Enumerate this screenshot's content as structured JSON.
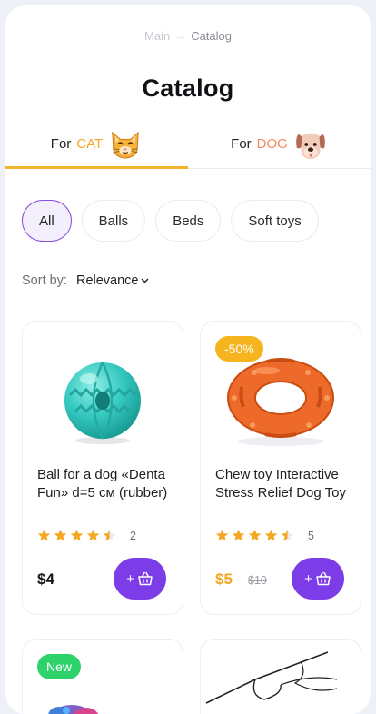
{
  "breadcrumb": {
    "home": "Main",
    "separator": "→",
    "current": "Catalog"
  },
  "title": "Catalog",
  "pet_tabs": [
    {
      "prefix": "For",
      "pet": "CAT",
      "icon": "cat-face-icon",
      "active": true
    },
    {
      "prefix": "For",
      "pet": "DOG",
      "icon": "dog-face-icon",
      "active": false
    }
  ],
  "filters": [
    "All",
    "Balls",
    "Beds",
    "Soft toys"
  ],
  "active_filter": "All",
  "sort": {
    "label": "Sort by:",
    "value": "Relevance",
    "icon": "chevron-down-icon"
  },
  "products": [
    {
      "title": "Ball for a dog «Denta Fun» d=5 см (rubber)",
      "rating": 4.5,
      "reviews": "2",
      "price": "$4",
      "old_price": "",
      "badge": "",
      "image": "turquoise-rubber-ball",
      "cart_label": "+",
      "cart_icon": "basket-icon"
    },
    {
      "title": "Chew toy Interactive Stress Relief Dog Toy",
      "rating": 4.5,
      "reviews": "5",
      "price": "$5",
      "old_price": "$10",
      "badge": "-50%",
      "image": "orange-rubber-ring",
      "cart_label": "+",
      "cart_icon": "basket-icon"
    },
    {
      "badge": "New",
      "image": "plush-toy"
    },
    {
      "badge": "",
      "image": "line-drawing-toy"
    }
  ],
  "colors": {
    "accent_purple": "#7c3ce8",
    "tab_underline": "#f3b32b",
    "sale_badge": "#f6b41f",
    "new_badge": "#2ed26b",
    "sale_price": "#f5a623",
    "star": "#f5a623"
  }
}
